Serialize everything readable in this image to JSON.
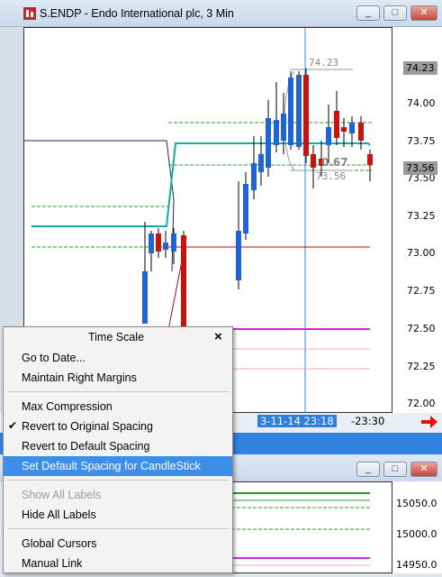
{
  "window": {
    "title": "S.ENDP - Endo International plc, 3 Min",
    "buttons": [
      "_",
      "□",
      "✕"
    ]
  },
  "chart": {
    "y_ticks": [
      "74.00",
      "73.75",
      "73.50",
      "73.25",
      "73.00",
      "72.75",
      "72.50",
      "72.25",
      "72.00"
    ],
    "price_badges": [
      "74.23",
      "73.56"
    ],
    "annotations": {
      "high": "74.23",
      "mid": "0.67",
      "low": "73.56"
    },
    "time_cursor": "3-11-14 23:18",
    "time_end": "-23:30"
  },
  "lower_window": {
    "y_ticks": [
      "15050.0",
      "15000.0",
      "14950.0"
    ]
  },
  "colors": {
    "up_candle": "#1f63d6",
    "down_candle": "#cc1111",
    "cyan_line": "#14a8b0",
    "green_dashed": "#22a022",
    "magenta": "#e020e0",
    "pink": "#f3a0c8",
    "selected": "#3d8ee8"
  },
  "menu": {
    "title": "Time Scale",
    "close": "×",
    "items": [
      {
        "label": "Go to Date..."
      },
      {
        "label": "Maintain Right Margins"
      },
      {
        "label": "Max Compression"
      },
      {
        "label": "Revert to Original Spacing",
        "checked": "✔"
      },
      {
        "label": "Revert to Default Spacing"
      },
      {
        "label": "Set Default Spacing for CandleStick"
      },
      {
        "label": "Show All Labels"
      },
      {
        "label": "Hide All Labels"
      },
      {
        "label": "Global Cursors"
      },
      {
        "label": "Manual Link"
      }
    ]
  }
}
